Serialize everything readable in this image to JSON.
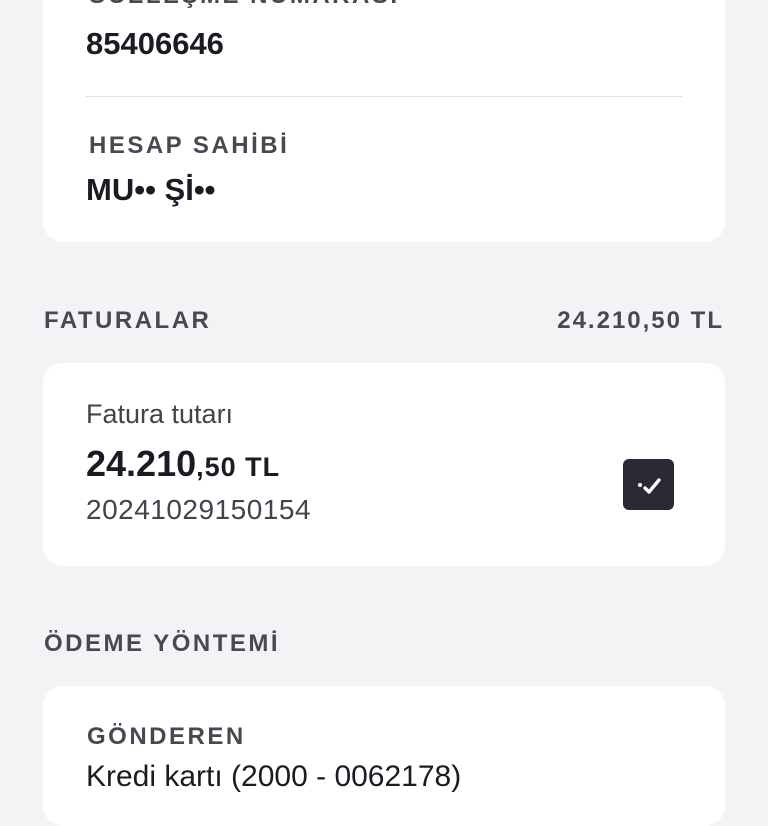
{
  "account": {
    "contract_label": "SÖZLEŞME NUMARASI",
    "contract_number": "85406646",
    "holder_label": "HESAP SAHİBİ",
    "holder_name": "MU•• Şİ••"
  },
  "invoices": {
    "section_title": "FATURALAR",
    "total": "24.210,50 TL",
    "items": [
      {
        "label": "Fatura tutarı",
        "amount_main": "24.210",
        "amount_fraction": ",50 TL",
        "invoice_id": "20241029150154",
        "selected": true
      }
    ]
  },
  "payment": {
    "section_title": "ÖDEME YÖNTEMİ",
    "sender_label": "GÖNDEREN",
    "sender_value": "Kredi kartı (2000 - 0062178)"
  },
  "colors": {
    "background": "#f3f3f6",
    "card": "#ffffff",
    "checkbox": "#2d2836"
  },
  "icons": {
    "checkbox": "check-icon"
  }
}
